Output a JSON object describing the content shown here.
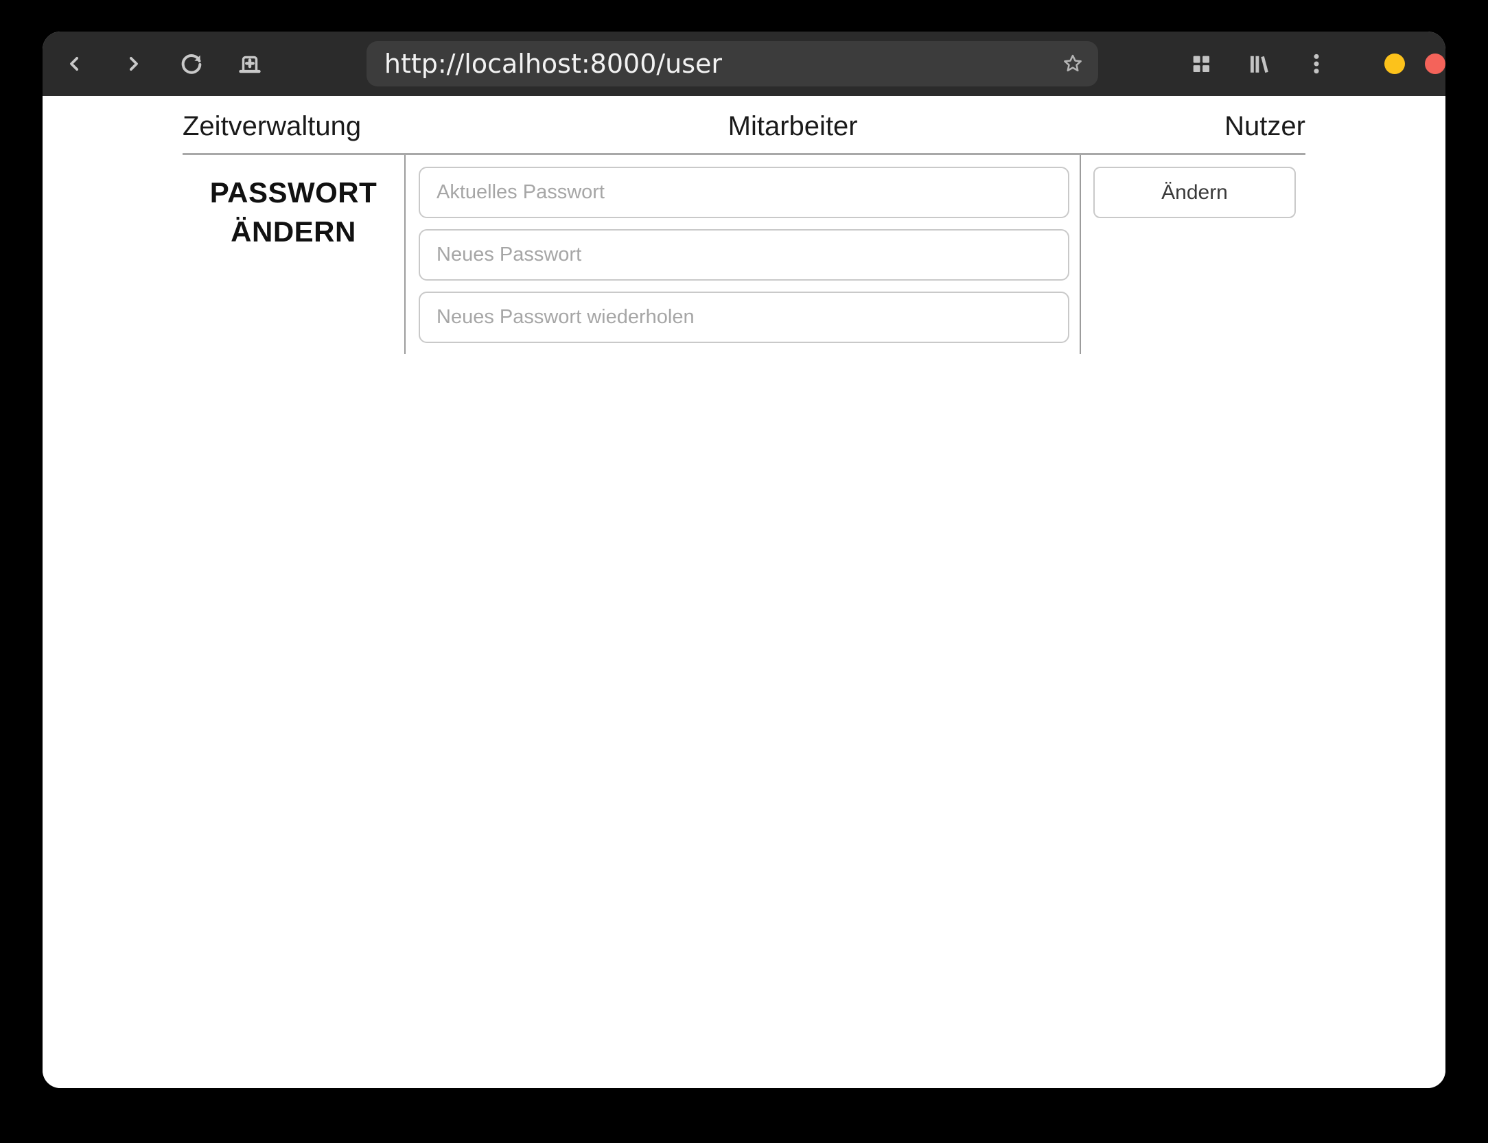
{
  "browser": {
    "url": "http://localhost:8000/user",
    "toolbar_icons": {
      "back": "back-chevron-icon",
      "forward": "forward-chevron-icon",
      "reload": "reload-icon",
      "new_tab": "new-tab-icon",
      "bookmark": "star-icon",
      "tab_overview": "grid-icon",
      "library": "library-icon",
      "menu": "kebab-menu-icon"
    },
    "colors": {
      "toolbar_bg": "#2b2b2b",
      "urlbar_bg": "#3c3c3c",
      "icon_gray": "#c9c9c9",
      "minimize_dot": "#fcc21b",
      "close_dot": "#f4635a"
    }
  },
  "nav": {
    "items": [
      {
        "label": "Zeitverwaltung"
      },
      {
        "label": "Mitarbeiter"
      },
      {
        "label": "Nutzer"
      }
    ]
  },
  "password_section": {
    "heading_line1": "PASSWORT",
    "heading_line2": "ÄNDERN",
    "fields": [
      {
        "placeholder": "Aktuelles Passwort",
        "value": ""
      },
      {
        "placeholder": "Neues Passwort",
        "value": ""
      },
      {
        "placeholder": "Neues Passwort wiederholen",
        "value": ""
      }
    ],
    "submit_label": "Ändern"
  }
}
